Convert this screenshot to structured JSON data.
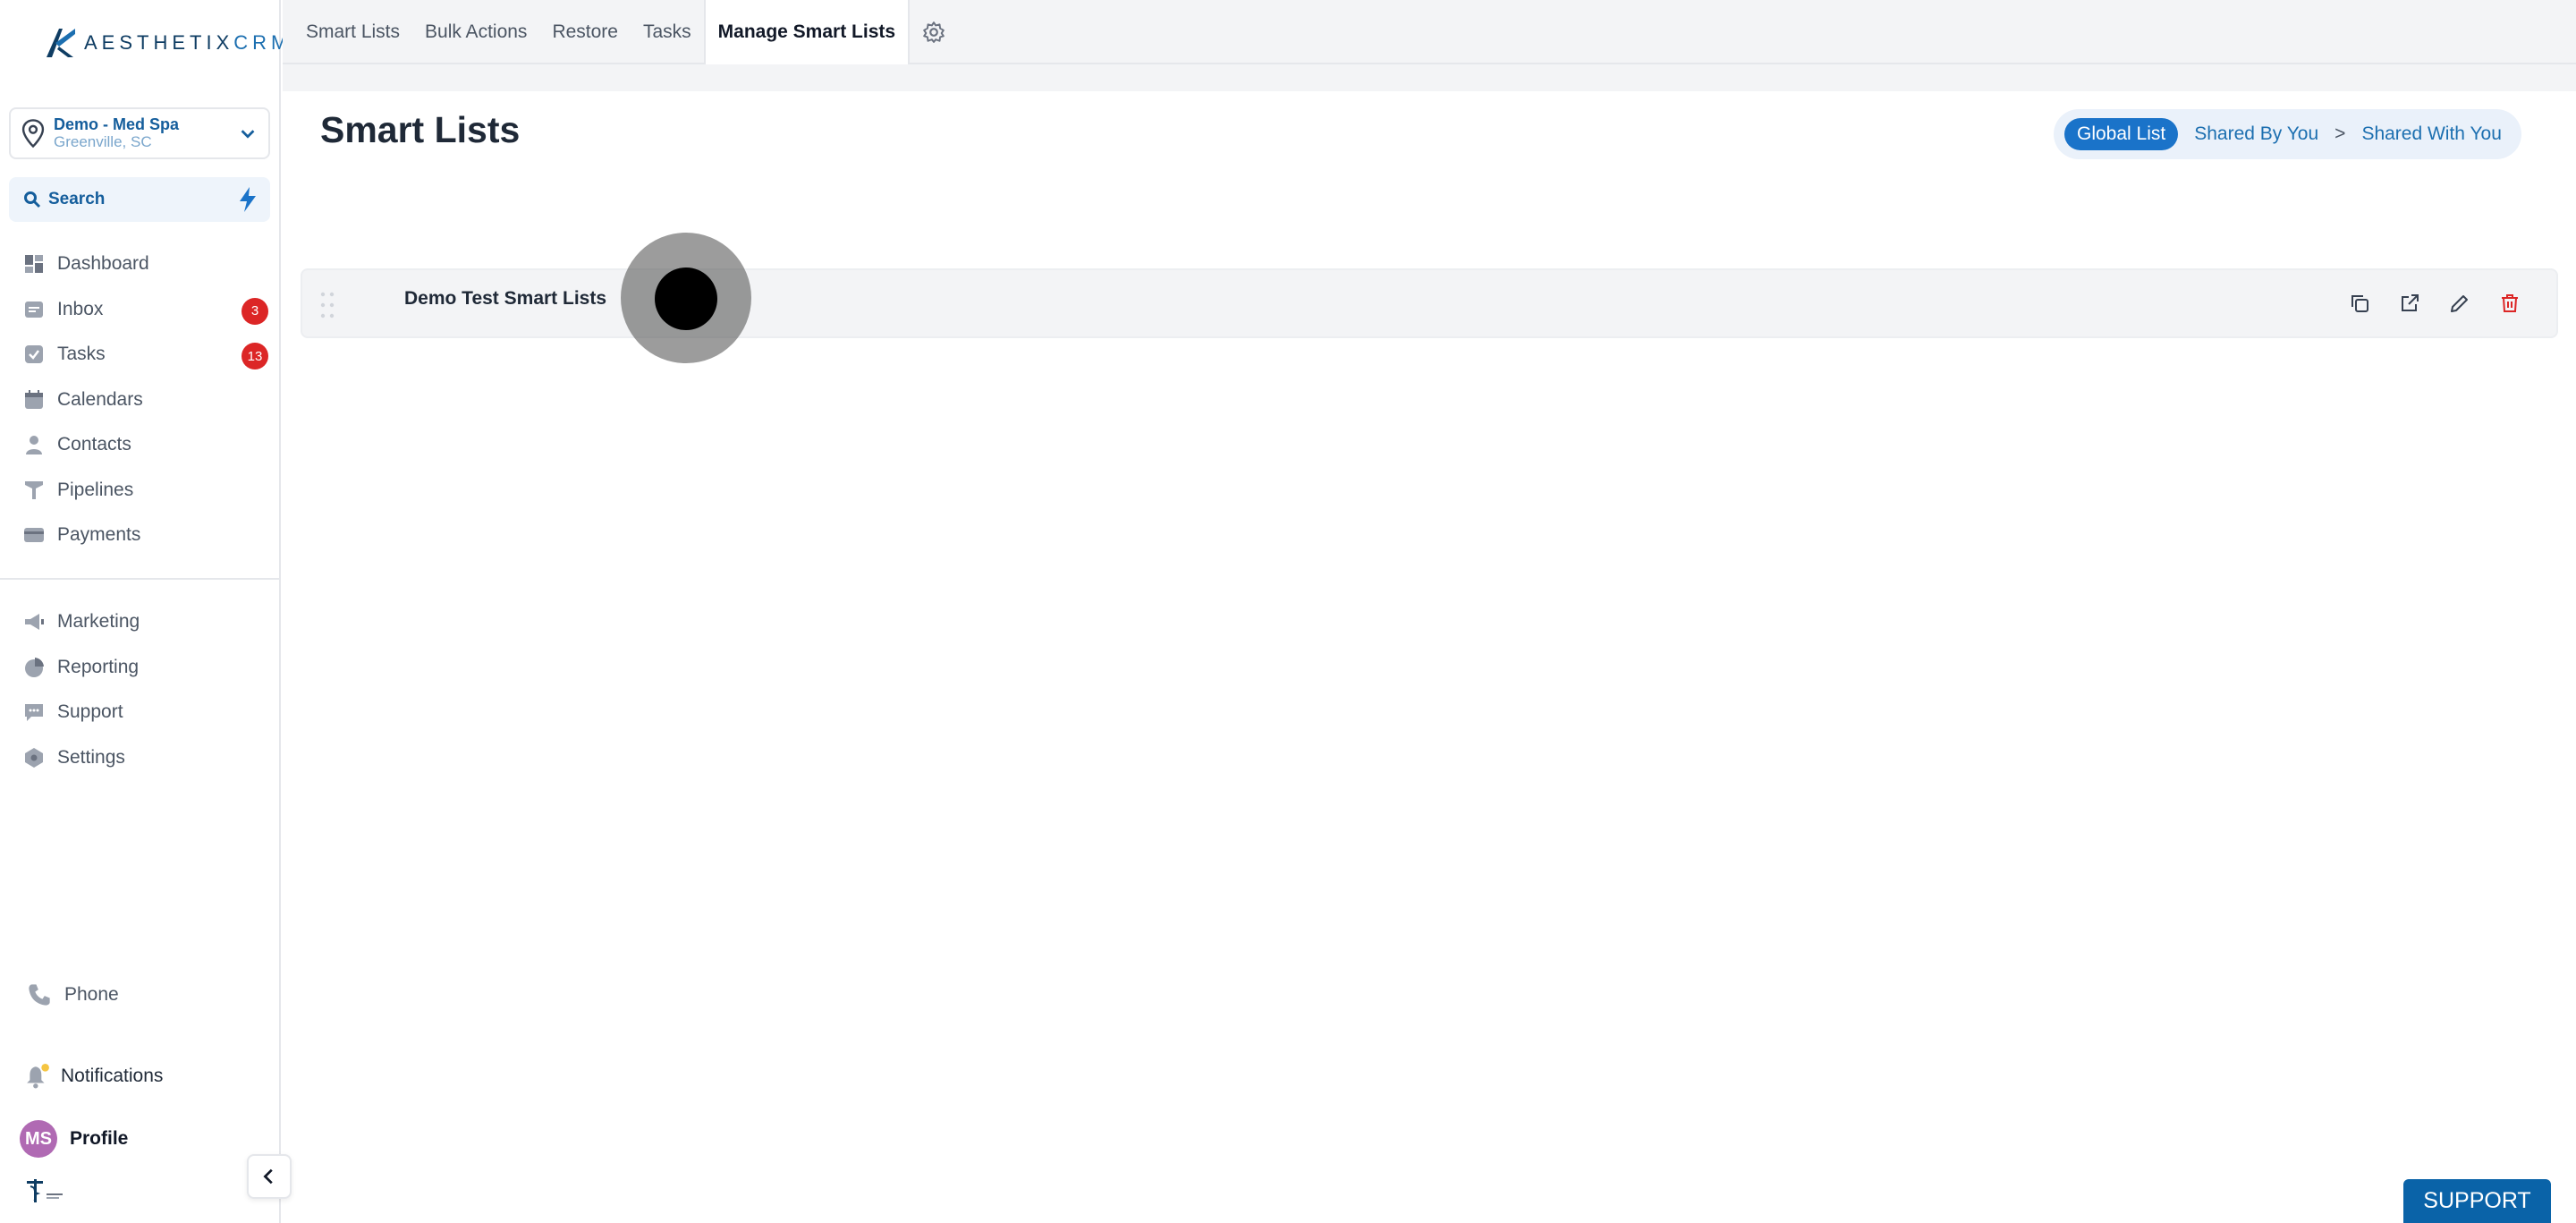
{
  "brand": {
    "name_a": "AESTHETIX",
    "name_b": "CRM"
  },
  "location": {
    "name": "Demo - Med Spa",
    "city": "Greenville, SC"
  },
  "search": {
    "label": "Search"
  },
  "nav_primary": [
    {
      "label": "Dashboard",
      "icon": "dashboard-icon"
    },
    {
      "label": "Inbox",
      "icon": "inbox-icon",
      "badge": "3"
    },
    {
      "label": "Tasks",
      "icon": "tasks-icon",
      "badge": "13"
    },
    {
      "label": "Calendars",
      "icon": "calendar-icon"
    },
    {
      "label": "Contacts",
      "icon": "contacts-icon"
    },
    {
      "label": "Pipelines",
      "icon": "pipelines-icon"
    },
    {
      "label": "Payments",
      "icon": "payments-icon"
    }
  ],
  "nav_secondary": [
    {
      "label": "Marketing",
      "icon": "megaphone-icon"
    },
    {
      "label": "Reporting",
      "icon": "pie-chart-icon"
    },
    {
      "label": "Support",
      "icon": "chat-icon"
    },
    {
      "label": "Settings",
      "icon": "settings-icon"
    }
  ],
  "bottom": {
    "phone": "Phone",
    "notifications": "Notifications",
    "profile": "Profile",
    "avatar_initials": "MS"
  },
  "tabs": [
    {
      "label": "Smart Lists"
    },
    {
      "label": "Bulk Actions"
    },
    {
      "label": "Restore"
    },
    {
      "label": "Tasks"
    },
    {
      "label": "Manage Smart Lists",
      "active": true
    }
  ],
  "page": {
    "title": "Smart Lists"
  },
  "segments": {
    "active": "Global List",
    "shared_by": "Shared By You",
    "separator": ">",
    "shared_with": "Shared With You"
  },
  "lists": [
    {
      "name": "Demo Test Smart Lists"
    }
  ],
  "support_button": "SUPPORT",
  "colors": {
    "accent": "#1a73c9",
    "brand_dark": "#0f3d63",
    "badge": "#dc2626",
    "delete": "#dc2626"
  }
}
